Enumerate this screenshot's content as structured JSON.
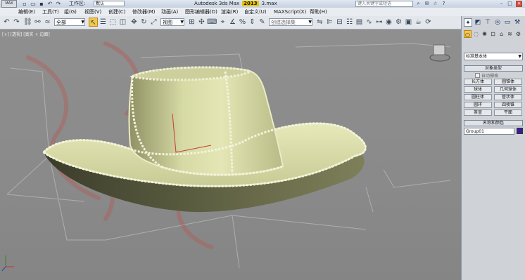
{
  "titlebar": {
    "logo": "MAX",
    "workspace_label": "工作区:",
    "workspace_value": "默认",
    "app_name": "Autodesk 3ds Max",
    "version": "2013",
    "file_name": "3.max",
    "search_placeholder": "键入关键字或短语"
  },
  "menubar": {
    "items": [
      "编辑(E)",
      "工具(T)",
      "组(G)",
      "视图(V)",
      "创建(C)",
      "修改器(M)",
      "动画(A)",
      "图形编辑器(D)",
      "渲染(R)",
      "自定义(U)",
      "MAXScript(X)",
      "帮助(H)"
    ]
  },
  "toolbar": {
    "filter_value": "全部",
    "view_value": "视图",
    "selection_set_placeholder": "创建选择集"
  },
  "viewport": {
    "label": "[+] [透视] [真实 + 边面]"
  },
  "command_panel": {
    "category_value": "标准基本体",
    "object_type_header": "对象类型",
    "autogrid_label": "自动栅格",
    "object_buttons": [
      "长方体",
      "圆锥体",
      "球体",
      "几何球体",
      "圆柱体",
      "管状体",
      "圆环",
      "四棱锥",
      "茶壶",
      "平面"
    ],
    "name_color_header": "名称和颜色",
    "object_name": "Group01",
    "object_color": "#3a1c9a"
  },
  "colors": {
    "accent": "#f3c84a",
    "viewport_bg": "#8a8a8a",
    "hat_fill": "#d8dca6"
  }
}
